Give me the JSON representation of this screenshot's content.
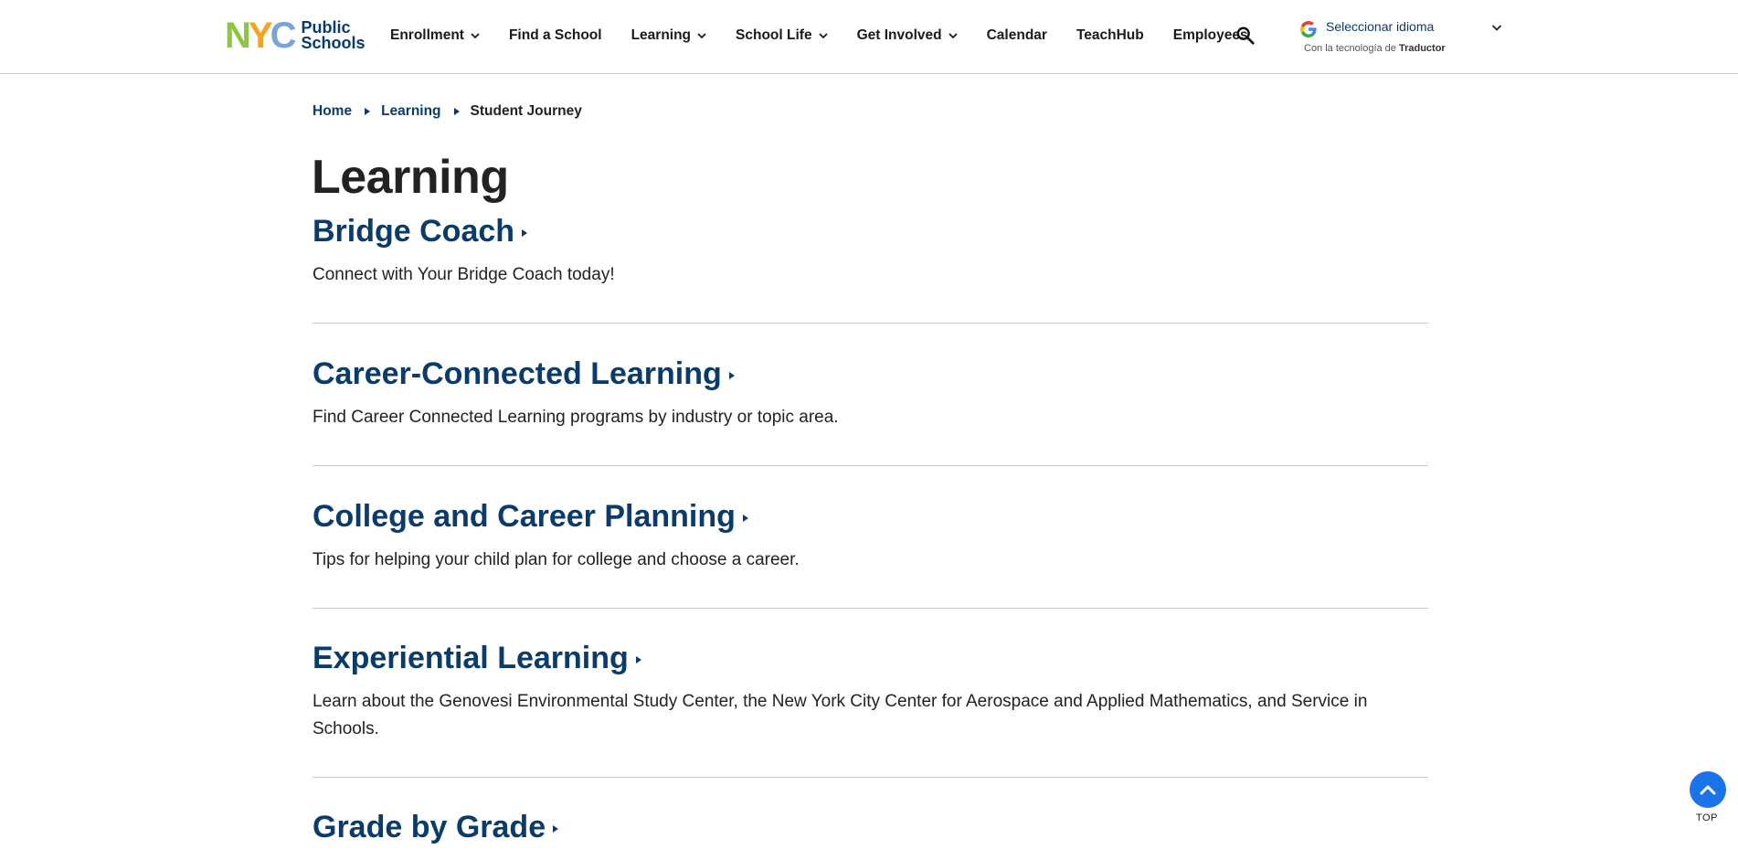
{
  "header": {
    "logo": {
      "letters": [
        "N",
        "Y",
        "C"
      ],
      "line1": "Public",
      "line2": "Schools"
    },
    "nav": [
      {
        "label": "Enrollment",
        "dropdown": true
      },
      {
        "label": "Find a School",
        "dropdown": false
      },
      {
        "label": "Learning",
        "dropdown": true
      },
      {
        "label": "School Life",
        "dropdown": true
      },
      {
        "label": "Get Involved",
        "dropdown": true
      },
      {
        "label": "Calendar",
        "dropdown": false
      },
      {
        "label": "TeachHub",
        "dropdown": false
      },
      {
        "label": "Employees",
        "dropdown": false
      }
    ],
    "search_icon": "search-icon",
    "translate": {
      "select_label": "Seleccionar idioma",
      "powered_prefix": "Con la tecnología de",
      "powered_brand": "Traductor"
    }
  },
  "breadcrumb": {
    "items": [
      "Home",
      "Learning"
    ],
    "current": "Student Journey"
  },
  "page": {
    "title": "Learning",
    "sections": [
      {
        "title": "Bridge Coach",
        "description": "Connect with Your Bridge Coach today!"
      },
      {
        "title": "Career-Connected Learning",
        "description": "Find Career Connected Learning programs by industry or topic area."
      },
      {
        "title": "College and Career Planning",
        "description": "Tips for helping your child plan for college and choose a career."
      },
      {
        "title": "Experiential Learning",
        "description": "Learn about the Genovesi Environmental Study Center, the New York City Center for Aerospace and Applied Mathematics, and Service in Schools."
      },
      {
        "title": "Grade by Grade",
        "description": ""
      }
    ]
  },
  "top_button": {
    "label": "TOP"
  },
  "colors": {
    "brand_blue": "#0b3b6b",
    "accent_blue": "#1a73e8",
    "nyc_green": "#8dc63f",
    "nyc_orange": "#f7a41d",
    "nyc_lightblue": "#7aa3d6"
  }
}
